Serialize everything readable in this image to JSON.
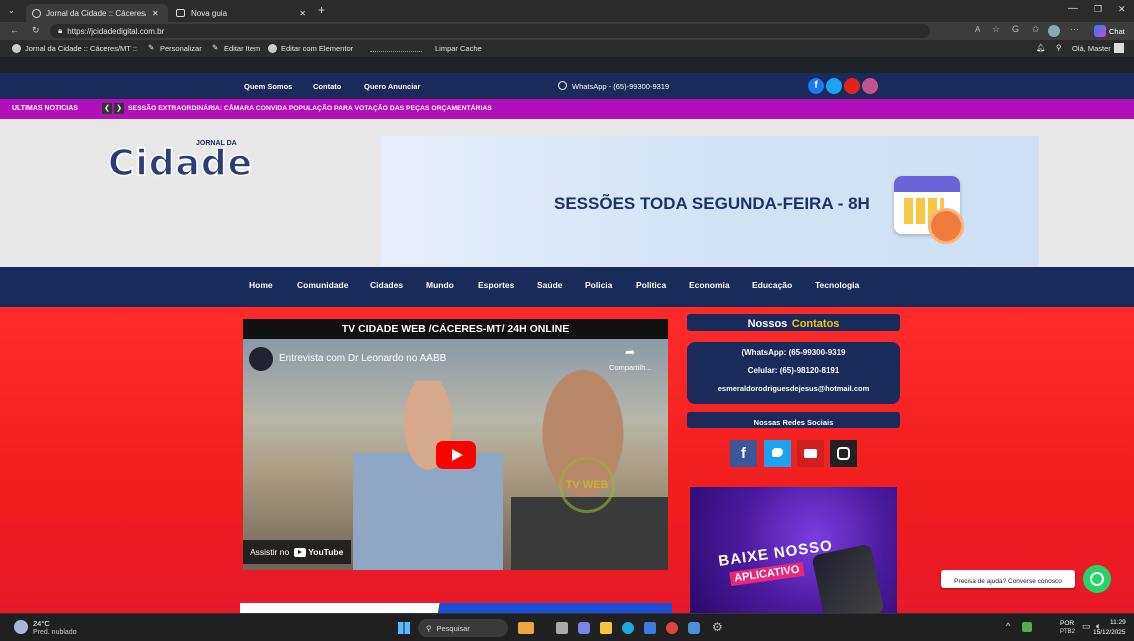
{
  "browser": {
    "tabs": [
      {
        "label": "Jornal da Cidade :: Cáceres/MT ::"
      },
      {
        "label": "Nova guia"
      }
    ],
    "new_tab_symbol": "+",
    "url": "https://jcidadedigital.com.br",
    "chat_label": "Chat"
  },
  "wp_admin_bar": {
    "site_name": "Jornal da Cidade :: Cáceres/MT ::",
    "customize": "Personalizar",
    "edit_item": "Editar Item",
    "edit_elementor": "Editar com Elementor",
    "clear_cache": "Limpar Cache",
    "greeting": "Olá, Master"
  },
  "top_nav": {
    "links": [
      "Quem Somos",
      "Contato",
      "Quero Anunciar"
    ],
    "whatsapp": "WhatsApp - (65)-99300-9319"
  },
  "ticker": {
    "label": "ULTIMAS NOTICIAS",
    "headline": "SESSÃO EXTRAORDINÁRIA: CÂMARA CONVIDA POPULAÇÃO PARA VOTAÇÃO DAS PEÇAS ORÇAMENTÁRIAS"
  },
  "header": {
    "logo_small": "JORNAL DA",
    "logo_big": "Cidade",
    "banner_text": "SESSÕES TODA SEGUNDA-FEIRA - 8H"
  },
  "main_nav": [
    "Home",
    "Comunidade",
    "Cidades",
    "Mundo",
    "Esportes",
    "Saúde",
    "Policia",
    "Politica",
    "Economia",
    "Educação",
    "Tecnologia"
  ],
  "video": {
    "section_title": "TV CIDADE WEB /CÁCERES-MT/ 24H ONLINE",
    "video_title": "Entrevista com Dr Leonardo no AABB",
    "share_label": "Compartilh...",
    "watch_on": "Assistir no",
    "youtube": "YouTube",
    "watermark": "TV WEB"
  },
  "contacts": {
    "title_a": "Nossos",
    "title_b": "Contatos",
    "whatsapp": "(WhatsApp: (65-99300-9319",
    "cell": "Celular: (65)-98120-8191",
    "email": "esmeraldorodriguesdejesus@hotmail.com",
    "social_title": "Nossas Redes Sociais"
  },
  "app_banner": {
    "line1": "BAIXE NOSSO",
    "line2": "APLICATIVO"
  },
  "chat_widget": {
    "text": "Precisa de ajuda? Converse conosco"
  },
  "taskbar": {
    "temp": "24°C",
    "weather": "Pred. nublado",
    "search": "Pesquisar",
    "lang1": "POR",
    "lang2": "PTB2",
    "time": "11:29",
    "date": "15/12/2025"
  },
  "colors": {
    "navy": "#1a2a5a",
    "ticker": "#b10fb8",
    "red": "#f01e1e",
    "contacts_yellow": "#f5c518"
  }
}
